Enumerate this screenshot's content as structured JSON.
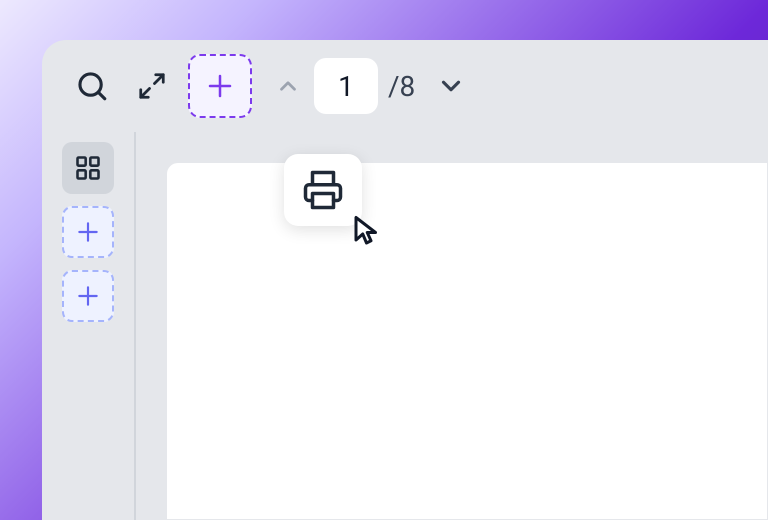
{
  "pagination": {
    "current_page": "1",
    "total_pages_label": "/8"
  },
  "icons": {
    "search": "search-icon",
    "expand": "expand-icon",
    "add": "plus-icon",
    "grid": "grid-icon",
    "print": "print-icon",
    "chevron_up": "chevron-up-icon",
    "chevron_down": "chevron-down-icon",
    "cursor": "cursor-icon"
  },
  "colors": {
    "accent": "#7c3aed",
    "accent_light": "#a5b4fc",
    "toolbar_bg": "#e5e7eb",
    "gradient_start": "#ede9fe",
    "gradient_end": "#4c1d95"
  }
}
